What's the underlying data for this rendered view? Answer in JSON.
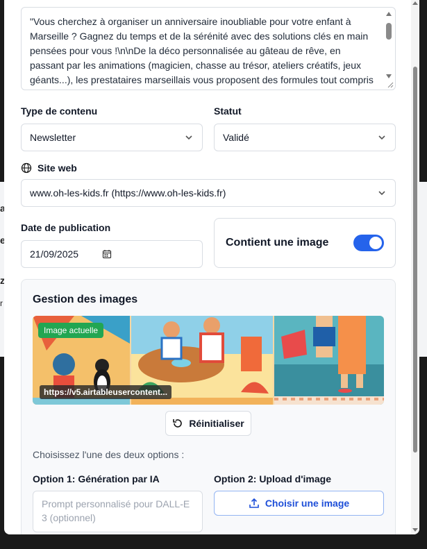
{
  "background": {
    "fragments": [
      "ai",
      "e",
      "z",
      "r"
    ]
  },
  "content_field": {
    "value": "\"Vous cherchez à organiser un anniversaire inoubliable pour votre enfant à Marseille ? Gagnez du temps et de la sérénité avec des solutions clés en main pensées pour vous !\\n\\nDe la déco personnalisée au gâteau de rêve, en passant par les animations (magicien, chasse au trésor, ateliers créatifs, jeux géants...), les prestataires marseillais vous proposent des formules tout compris et adaptées à chaque âge.\\n\\nVoici quelques idées qui cartonnent :\\n - Anniversaire pirates sur"
  },
  "type_contenu": {
    "label": "Type de contenu",
    "value": "Newsletter"
  },
  "statut": {
    "label": "Statut",
    "value": "Validé"
  },
  "site_web": {
    "label": "Site web",
    "value": "www.oh-les-kids.fr (https://www.oh-les-kids.fr)"
  },
  "date_publication": {
    "label": "Date de publication",
    "value": "21/09/2025"
  },
  "contient_image": {
    "label": "Contient une image",
    "enabled": true
  },
  "gestion": {
    "title": "Gestion des images",
    "badge": "Image actuelle",
    "url": "https://v5.airtableusercontent...",
    "reset_label": "Réinitialiser",
    "choose_text": "Choisissez l'une des deux options :",
    "option1_label": "Option 1: Génération par IA",
    "option2_label": "Option 2: Upload d'image",
    "prompt_placeholder": "Prompt personnalisé pour DALL-E 3 (optionnel)",
    "upload_label": "Choisir une image"
  },
  "colors": {
    "accent": "#2563eb",
    "badge": "#22a652"
  }
}
